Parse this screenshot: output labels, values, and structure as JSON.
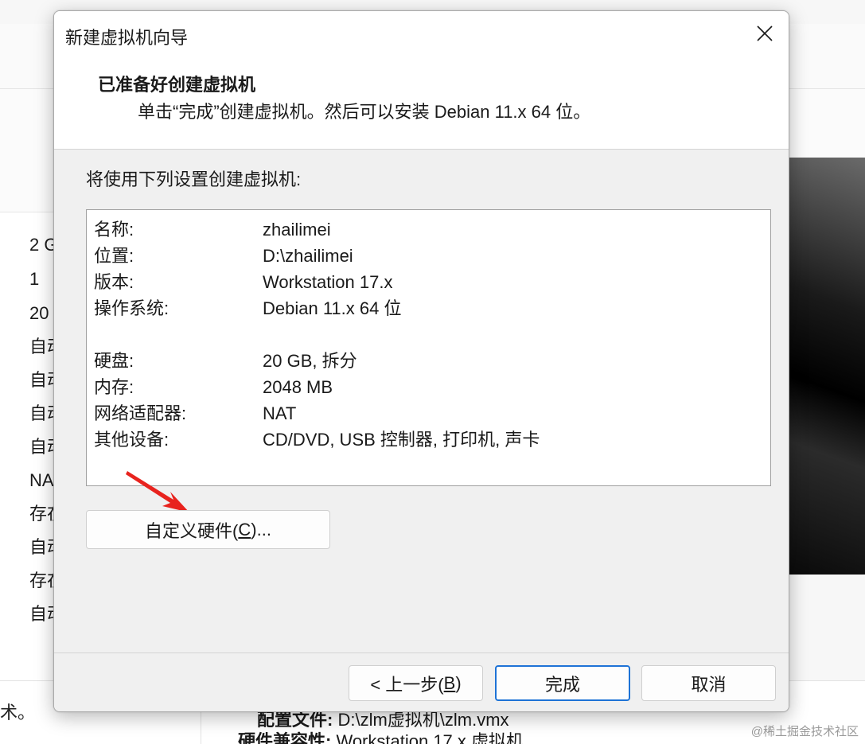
{
  "background": {
    "list_items": [
      "2 G",
      "1",
      "20",
      "自动",
      "自动",
      "自动",
      "自动",
      "NA",
      "存在",
      "自动",
      "存在",
      "自动"
    ],
    "bottom_left_text": "术。",
    "bottom_rows": [
      {
        "key": "配置文件:",
        "value": "D:\\zlm虚拟机\\zlm.vmx"
      },
      {
        "key": "硬件兼容性:",
        "value": "Workstation 17.x 虚拟机"
      }
    ],
    "watermark": "@稀土掘金技术社区"
  },
  "dialog": {
    "title": "新建虚拟机向导",
    "close_icon": "close-icon",
    "header": {
      "title": "已准备好创建虚拟机",
      "subtitle": "单击“完成”创建虚拟机。然后可以安装 Debian 11.x 64 位。"
    },
    "summary_label": "将使用下列设置创建虚拟机:",
    "summary": [
      {
        "key": "名称:",
        "value": "zhailimei"
      },
      {
        "key": "位置:",
        "value": "D:\\zhailimei"
      },
      {
        "key": "版本:",
        "value": "Workstation 17.x"
      },
      {
        "key": "操作系统:",
        "value": "Debian 11.x 64 位"
      },
      {
        "key": "硬盘:",
        "value": "20 GB, 拆分"
      },
      {
        "key": "内存:",
        "value": "2048 MB"
      },
      {
        "key": "网络适配器:",
        "value": "NAT"
      },
      {
        "key": "其他设备:",
        "value": "CD/DVD, USB 控制器, 打印机, 声卡"
      }
    ],
    "customize_button": {
      "pre": "自定义硬件(",
      "key": "C",
      "post": ")..."
    },
    "back_button": {
      "pre": "< 上一步(",
      "key": "B",
      "post": ")"
    },
    "finish_button": "完成",
    "cancel_button": "取消",
    "accent_color": "#1e73d6",
    "arrow_color": "#e8231e"
  }
}
